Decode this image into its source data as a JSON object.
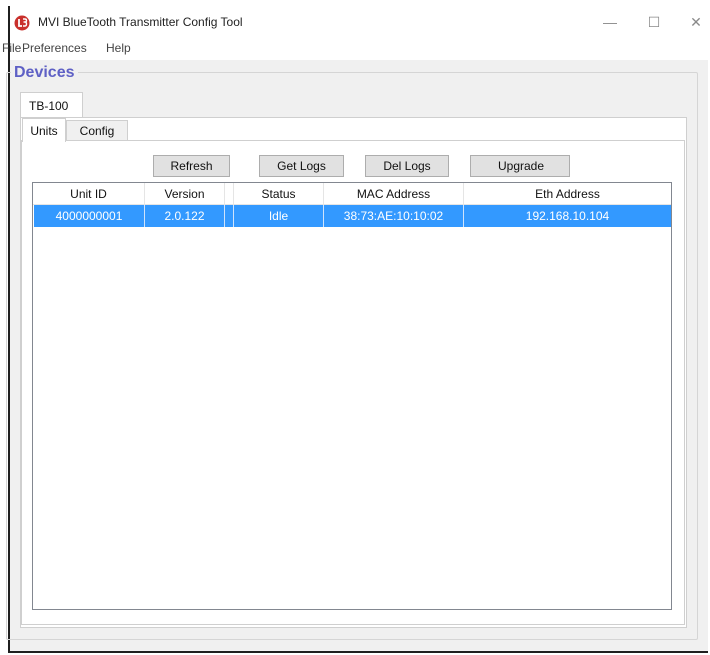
{
  "window": {
    "title": "MVI BlueTooth Transmitter Config Tool",
    "minimize": "—",
    "maximize": "☐",
    "close": "✕"
  },
  "menu": [
    "File",
    "Preferences",
    "Help"
  ],
  "devices": {
    "title": "Devices",
    "device_tab": "TB-100",
    "tabs": [
      "Units",
      "Config"
    ],
    "buttons": {
      "refresh": "Refresh",
      "get_logs": "Get Logs",
      "del_logs": "Del Logs",
      "upgrade": "Upgrade"
    },
    "table": {
      "columns": [
        "Unit ID",
        "Version",
        "Status",
        "MAC Address",
        "Eth Address"
      ],
      "rows": [
        [
          "4000000001",
          "2.0.122",
          "Idle",
          "38:73:AE:10:10:02",
          "192.168.10.104"
        ]
      ]
    }
  },
  "colors": {
    "selection": "#3399ff",
    "group_title": "#5e60c5",
    "app_icon": "#c9302c"
  },
  "icons": {
    "app": "app-logo-icon"
  }
}
